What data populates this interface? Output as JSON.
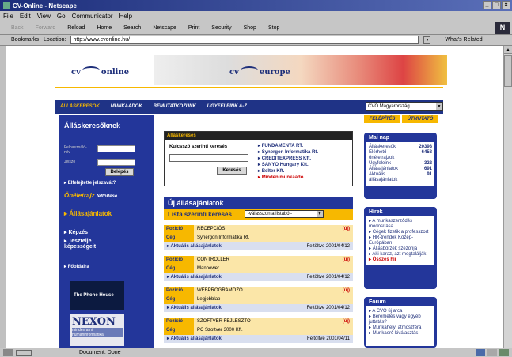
{
  "window": {
    "title": "CV-Online - Netscape"
  },
  "menu": [
    "File",
    "Edit",
    "View",
    "Go",
    "Communicator",
    "Help"
  ],
  "nav": {
    "back": "Back",
    "forward": "Forward",
    "buttons": [
      "Reload",
      "Home",
      "Search",
      "Netscape",
      "Print",
      "Security",
      "Shop",
      "Stop"
    ]
  },
  "location": {
    "bookmarks": "Bookmarks",
    "label": "Location:",
    "url": "http://www.cvonline.hu/",
    "whats_related": "What's Related"
  },
  "header": {
    "cv1": "cv",
    "online": "online",
    "cv2": "cv",
    "europe": "europe"
  },
  "tabs": [
    "ÁLLÁSKERESŐK",
    "MUNKAADÓK",
    "BEMUTATKOZUNK",
    "ÜGYFELEINK A-Z"
  ],
  "country_select": "CVO Magyarország",
  "subtabs": [
    "FELÉPÍTÉS",
    "ÚTMUTATÓ"
  ],
  "sidebar": {
    "title": "Álláskeresőknek",
    "user_label": "Felhasználó-név",
    "pass_label": "Jelszó",
    "login_btn": "Belépés",
    "forgot": "Elfelejtette jelszavát?",
    "cv_upload": "Önéletrajz",
    "cv_upload_suffix": "feltöltése",
    "menu": [
      "Állásajánlatok",
      "Képzés",
      "Tesztelje képességeit",
      "Főoldalra"
    ]
  },
  "banners": {
    "phone": "The Phone House",
    "nexon": "NEXON",
    "nexon_sub": "minden ami humáninformatika"
  },
  "advanced": {
    "header": "Álláskeresés",
    "keyword_label": "Kulcsszó szerinti keresés",
    "search_btn": "Keresés",
    "companies": [
      "FUNDAMENTA RT.",
      "Synergon Informatika Rt.",
      "CREDITEXPRESS Kft.",
      "SANYO Hungary Kft.",
      "Belter Kft.",
      "Minden munkaadó"
    ]
  },
  "jobs": {
    "header": "Új állásajánlatok",
    "list_search": "Lista szerinti keresés",
    "select": "-válasszon a listából-",
    "position_label": "Pozíció",
    "company_label": "Cég",
    "new_tag": "(új)",
    "current_link": "Aktuális állásajánlatok",
    "posted_prefix": "Feltöltve",
    "items": [
      {
        "position": "RECEPCIÓS",
        "company": "Synergon Informatika Rt.",
        "date": "2001/04/12"
      },
      {
        "position": "CONTROLLER",
        "company": "Manpower",
        "date": "2001/04/12"
      },
      {
        "position": "WEBPROGRAMOZÓ",
        "company": "Legjobblap",
        "date": "2001/04/12"
      },
      {
        "position": "SZOFTVER FEJLESZTŐ",
        "company": "PC Szoftver 3000 Kft.",
        "date": "2001/04/11"
      }
    ]
  },
  "mainap": {
    "title": "Mai nap",
    "rows": [
      [
        "Álláskeresők",
        "20398"
      ],
      [
        "Elérhető önéletrajzok",
        "6458"
      ],
      [
        "Ügyfeleink",
        "322"
      ],
      [
        "Állásajánlatok",
        "691"
      ],
      [
        "Aktuális állásajánlatok",
        "91"
      ]
    ]
  },
  "hirek": {
    "title": "Hírek",
    "items": [
      "A munkaszerződés módosítása",
      "Cégek fizetik a professzort",
      "HR-trendek Közép-Európában",
      "Állásbörzék szezonja",
      "Aki karaz, azt megtalálják"
    ],
    "all": "Összes hír"
  },
  "forum": {
    "title": "Fórum",
    "items": [
      "A CVO új arca",
      "Béremelés vagy egyéb juttatás?",
      "Munkahelyi atmoszféra",
      "Munkaerő kiválasztás"
    ]
  },
  "status": {
    "text": "Document: Done"
  }
}
